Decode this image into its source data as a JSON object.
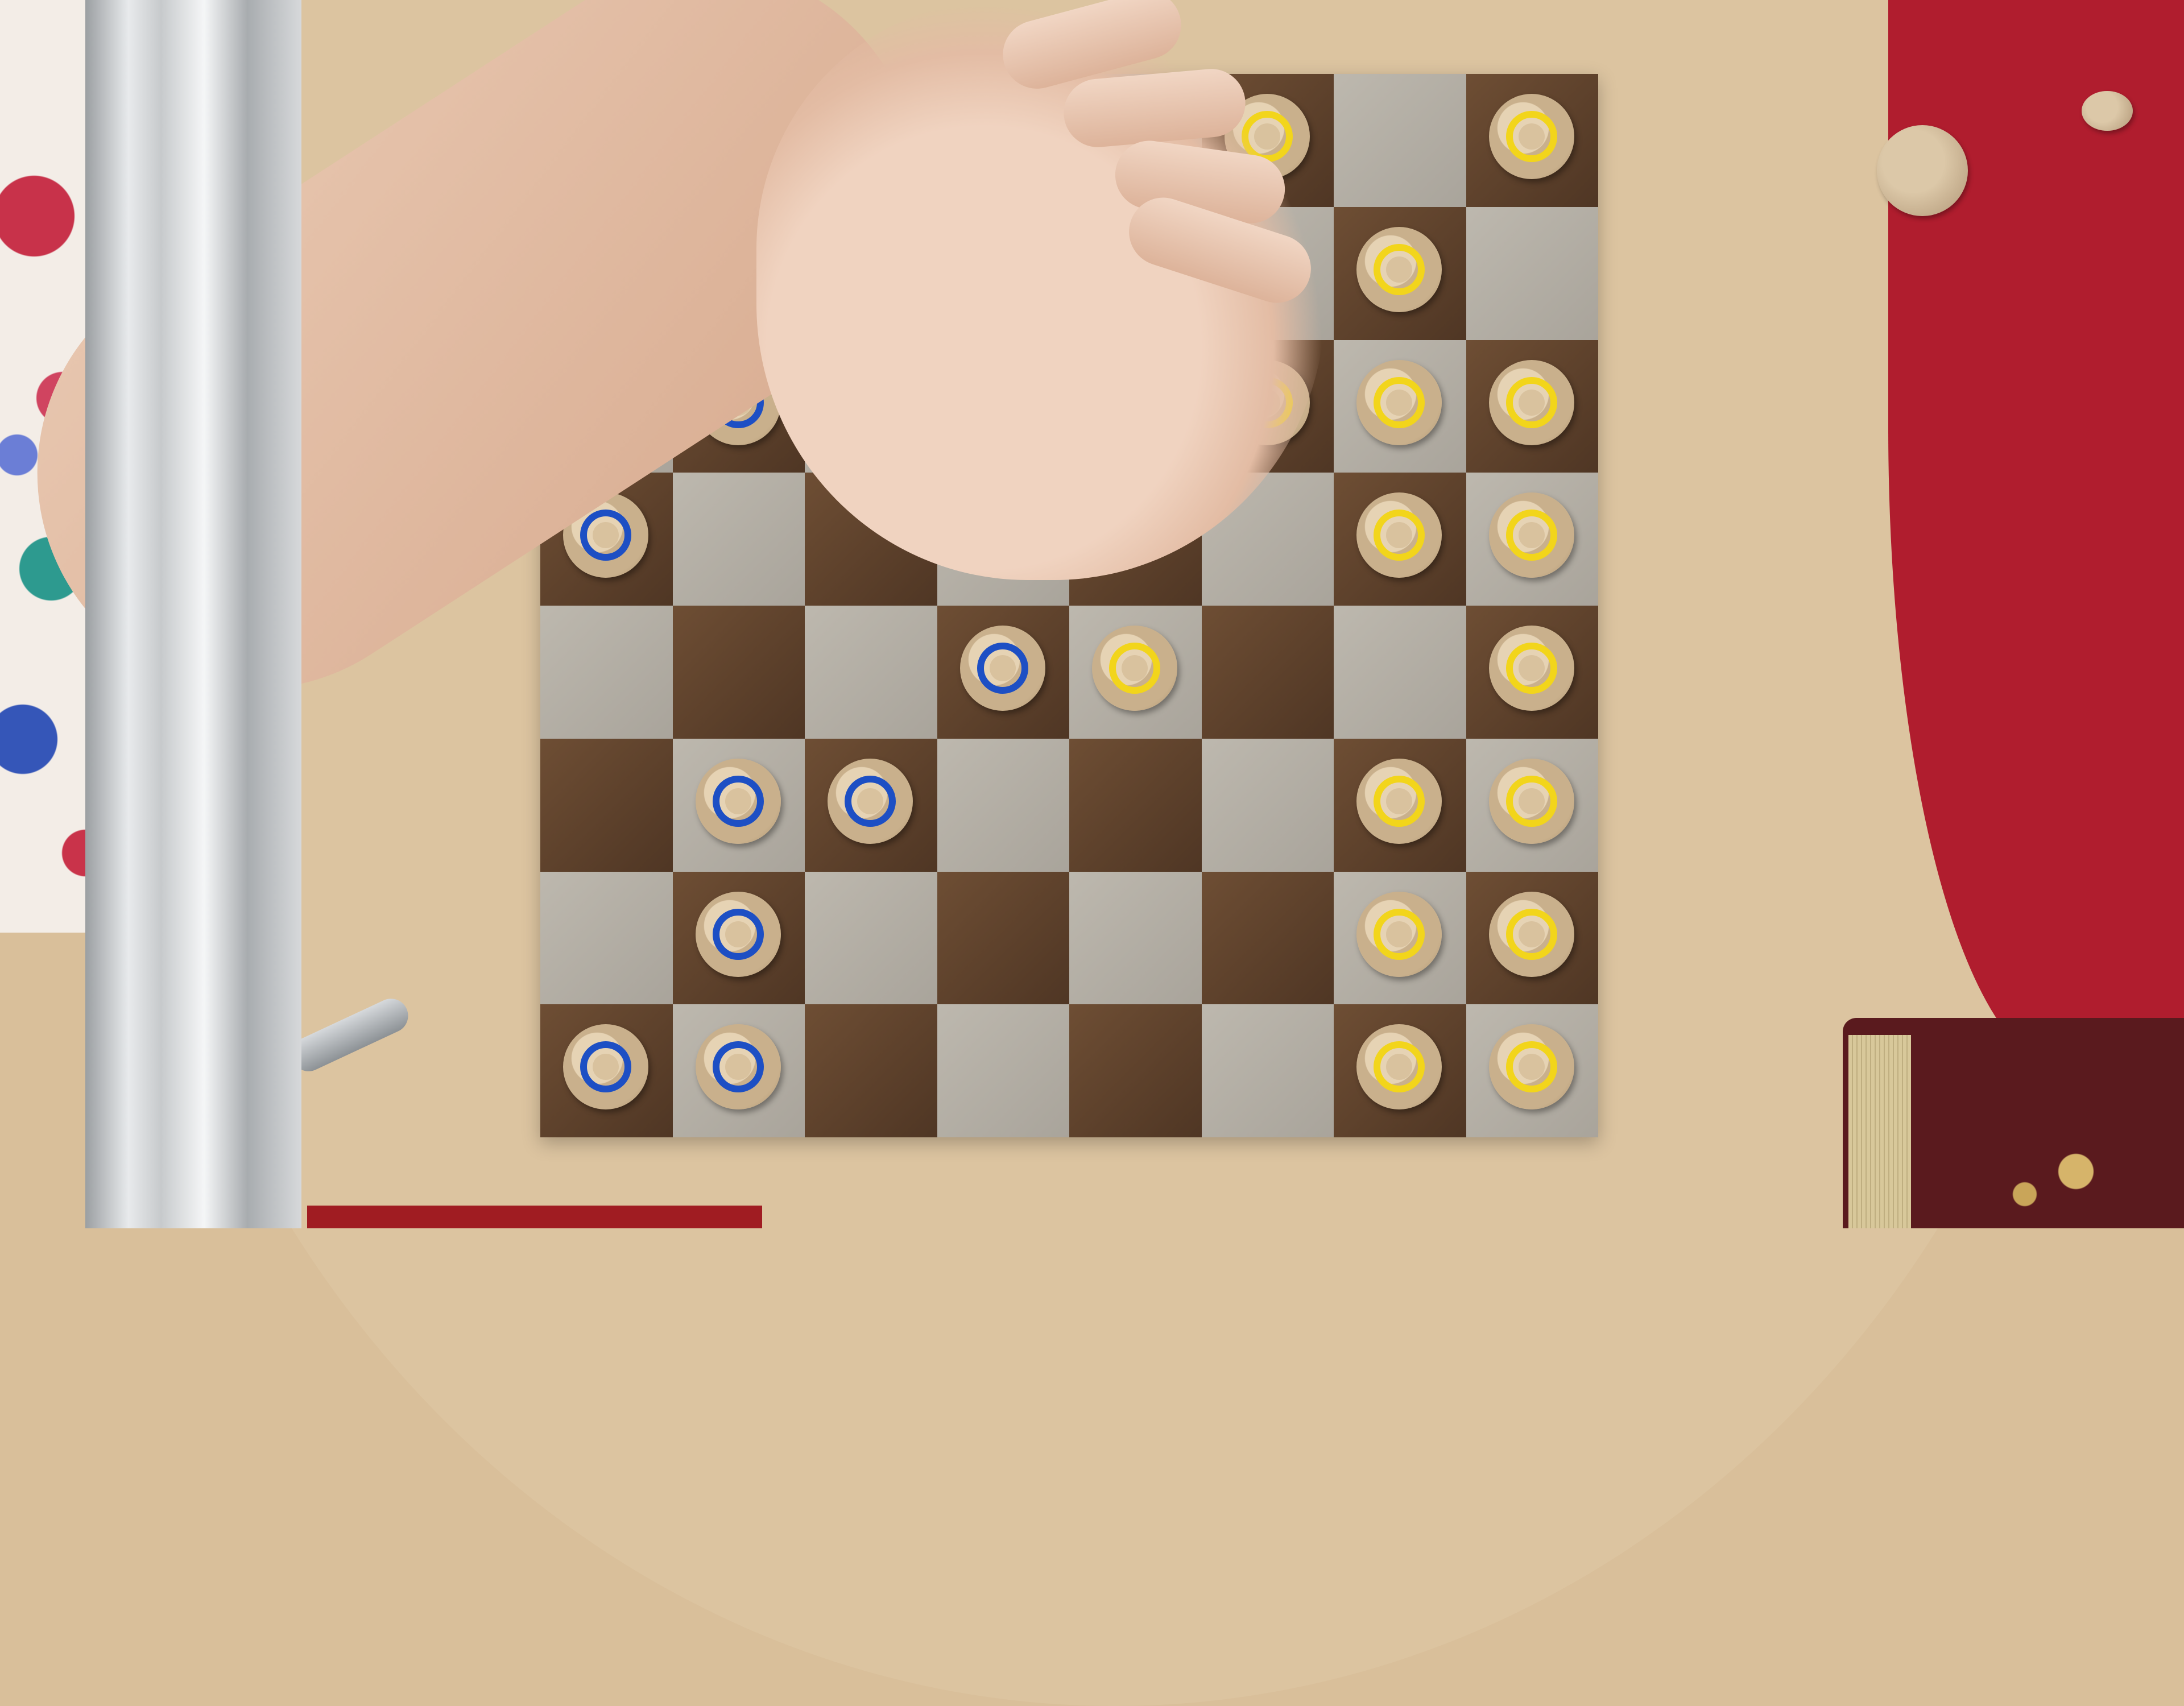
{
  "scene": {
    "description_label": "",
    "colors": {
      "blue_ring": "#1d4fc4",
      "yellow_ring": "#f2d51b",
      "light_square": "#bdb8ae",
      "dark_square": "#6e4e34"
    }
  }
}
